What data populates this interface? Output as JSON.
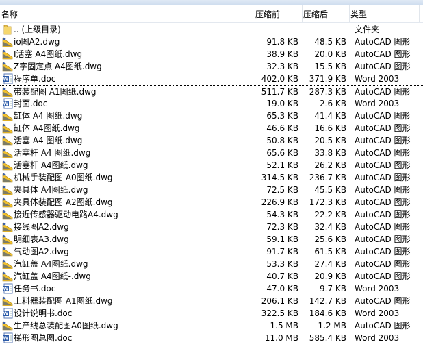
{
  "header": {
    "name": "名称",
    "before": "压缩前",
    "after": "压缩后",
    "type": "类型"
  },
  "files": [
    {
      "name": ".. (上级目录)",
      "before": "",
      "after": "",
      "type": "文件夹",
      "icon": "folder"
    },
    {
      "name": "io图A2.dwg",
      "before": "91.8 KB",
      "after": "48.5 KB",
      "type": "AutoCAD 图形",
      "icon": "dwg"
    },
    {
      "name": "I活塞 A4图纸.dwg",
      "before": "38.9 KB",
      "after": "20.0 KB",
      "type": "AutoCAD 图形",
      "icon": "dwg"
    },
    {
      "name": "Z字固定点 A4图纸.dwg",
      "before": "32.3 KB",
      "after": "15.5 KB",
      "type": "AutoCAD 图形",
      "icon": "dwg"
    },
    {
      "name": "程序单.doc",
      "before": "402.0 KB",
      "after": "371.9 KB",
      "type": "Word 2003",
      "icon": "doc"
    },
    {
      "name": "带装配图 A1图纸.dwg",
      "before": "511.7 KB",
      "after": "287.3 KB",
      "type": "AutoCAD 图形",
      "icon": "dwg"
    },
    {
      "name": "封面.doc",
      "before": "19.0 KB",
      "after": "2.6 KB",
      "type": "Word 2003",
      "icon": "doc"
    },
    {
      "name": "缸体 A4 图纸.dwg",
      "before": "65.3 KB",
      "after": "41.4 KB",
      "type": "AutoCAD 图形",
      "icon": "dwg"
    },
    {
      "name": "缸体 A4图纸.dwg",
      "before": "46.6 KB",
      "after": "16.6 KB",
      "type": "AutoCAD 图形",
      "icon": "dwg"
    },
    {
      "name": "活塞 A4 图纸.dwg",
      "before": "50.8 KB",
      "after": "20.5 KB",
      "type": "AutoCAD 图形",
      "icon": "dwg"
    },
    {
      "name": "活塞杆 A4 图纸.dwg",
      "before": "65.6 KB",
      "after": "33.8 KB",
      "type": "AutoCAD 图形",
      "icon": "dwg"
    },
    {
      "name": "活塞杆 A4图纸.dwg",
      "before": "52.1 KB",
      "after": "26.2 KB",
      "type": "AutoCAD 图形",
      "icon": "dwg"
    },
    {
      "name": "机械手装配图 A0图纸.dwg",
      "before": "314.5 KB",
      "after": "236.7 KB",
      "type": "AutoCAD 图形",
      "icon": "dwg"
    },
    {
      "name": "夹具体 A4图纸.dwg",
      "before": "72.5 KB",
      "after": "45.5 KB",
      "type": "AutoCAD 图形",
      "icon": "dwg"
    },
    {
      "name": "夹具体装配图 A2图纸.dwg",
      "before": "226.9 KB",
      "after": "172.3 KB",
      "type": "AutoCAD 图形",
      "icon": "dwg"
    },
    {
      "name": "接近传感器驱动电路A4.dwg",
      "before": "54.3 KB",
      "after": "22.2 KB",
      "type": "AutoCAD 图形",
      "icon": "dwg"
    },
    {
      "name": "接线图A2.dwg",
      "before": "72.3 KB",
      "after": "32.4 KB",
      "type": "AutoCAD 图形",
      "icon": "dwg"
    },
    {
      "name": "明细表A3.dwg",
      "before": "59.1 KB",
      "after": "25.6 KB",
      "type": "AutoCAD 图形",
      "icon": "dwg"
    },
    {
      "name": "气动图A2.dwg",
      "before": "91.7 KB",
      "after": "61.5 KB",
      "type": "AutoCAD 图形",
      "icon": "dwg"
    },
    {
      "name": "汽缸盖 A4图纸.dwg",
      "before": "53.3 KB",
      "after": "27.4 KB",
      "type": "AutoCAD 图形",
      "icon": "dwg"
    },
    {
      "name": "汽缸盖 A4图纸-.dwg",
      "before": "40.7 KB",
      "after": "20.9 KB",
      "type": "AutoCAD 图形",
      "icon": "dwg"
    },
    {
      "name": "任务书.doc",
      "before": "47.0 KB",
      "after": "9.7 KB",
      "type": "Word 2003",
      "icon": "doc"
    },
    {
      "name": "上料器装配图 A1图纸.dwg",
      "before": "206.1 KB",
      "after": "142.7 KB",
      "type": "AutoCAD 图形",
      "icon": "dwg"
    },
    {
      "name": "设计说明书.doc",
      "before": "322.5 KB",
      "after": "184.6 KB",
      "type": "Word 2003",
      "icon": "doc"
    },
    {
      "name": "生产线总装配图A0图纸.dwg",
      "before": "1.5 MB",
      "after": "1.2 MB",
      "type": "AutoCAD 图形",
      "icon": "dwg"
    },
    {
      "name": "梯形图总图.doc",
      "before": "11.0 MB",
      "after": "585.4 KB",
      "type": "Word 2003",
      "icon": "doc"
    }
  ],
  "focused_index": 5
}
